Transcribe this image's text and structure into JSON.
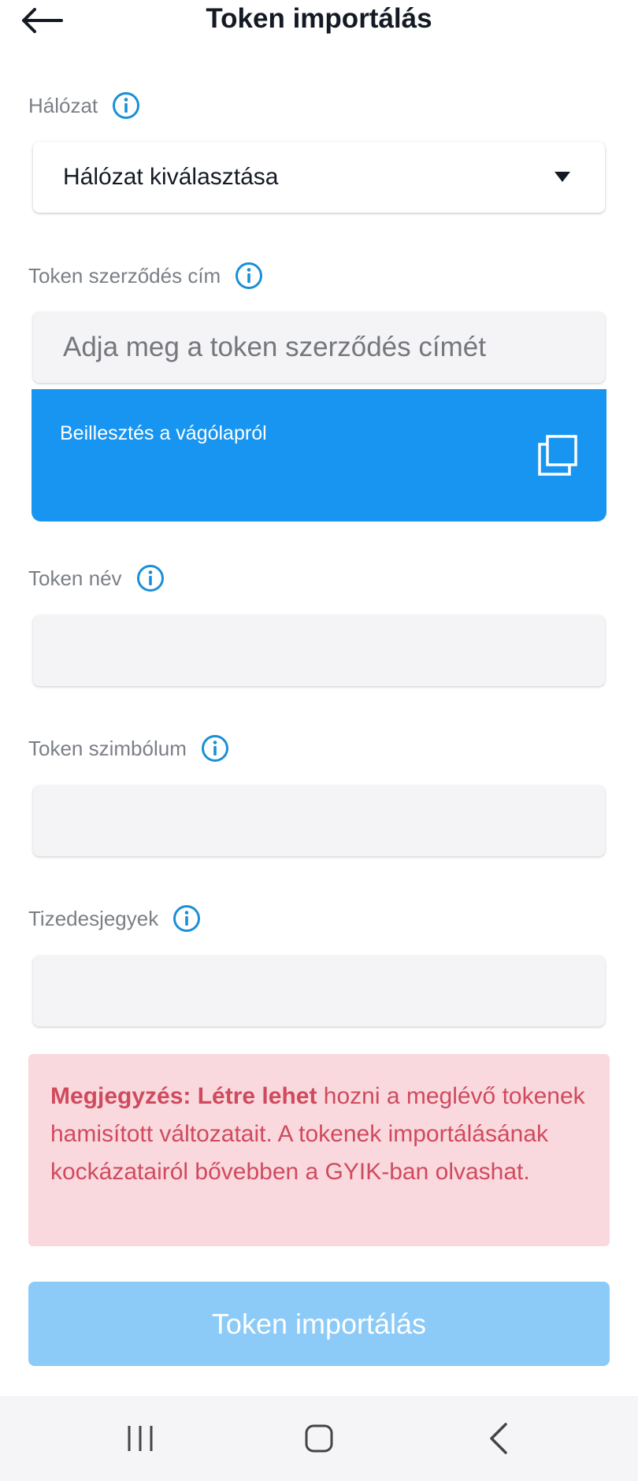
{
  "header": {
    "title": "Token importálás",
    "back_icon": "arrow-left-icon"
  },
  "network": {
    "label": "Hálózat",
    "select_value": "Hálózat kiválasztása"
  },
  "contract": {
    "label": "Token szerződés cím",
    "placeholder": "Adja meg a token szerződés címét",
    "value": "",
    "paste_label": "Beillesztés a vágólapról"
  },
  "token_name": {
    "label": "Token név",
    "value": ""
  },
  "token_symbol": {
    "label": "Token szimbólum",
    "value": ""
  },
  "decimals": {
    "label": "Tizedesjegyek",
    "value": ""
  },
  "note": {
    "bold": "Megjegyzés: Létre lehet",
    "text": " hozni a meglévő tokenek hamisított változatait. A tokenek importálásának kockázatairól bővebben a GYIK-ban olvashat."
  },
  "import_button": {
    "label": "Token importálás"
  },
  "colors": {
    "accent": "#1895f0",
    "info_icon": "#1a8fd8",
    "disabled_button": "#8ccaf7",
    "note_bg": "#f9d9de",
    "note_text": "#d04a5e"
  },
  "navbar": {
    "icons": [
      "recent-apps-icon",
      "home-icon",
      "back-icon"
    ]
  }
}
